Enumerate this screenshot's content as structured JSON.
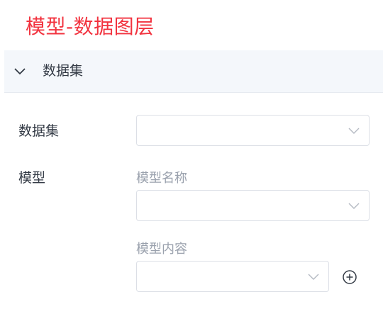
{
  "panel": {
    "title": "模型-数据图层"
  },
  "section": {
    "label": "数据集",
    "expanded": true,
    "toggle_icon": "chevron-down-icon"
  },
  "form": {
    "dataset": {
      "label": "数据集",
      "value": ""
    },
    "model": {
      "label": "模型",
      "name_label": "模型名称",
      "name_value": "",
      "content_label": "模型内容",
      "content_value": "",
      "add_icon": "plus-circle-icon"
    }
  },
  "colors": {
    "title": "#f2333f",
    "section_bg": "#f4f7fb",
    "border": "#dcdfe6",
    "text": "#333a45",
    "muted_text": "#9aa1ad"
  }
}
